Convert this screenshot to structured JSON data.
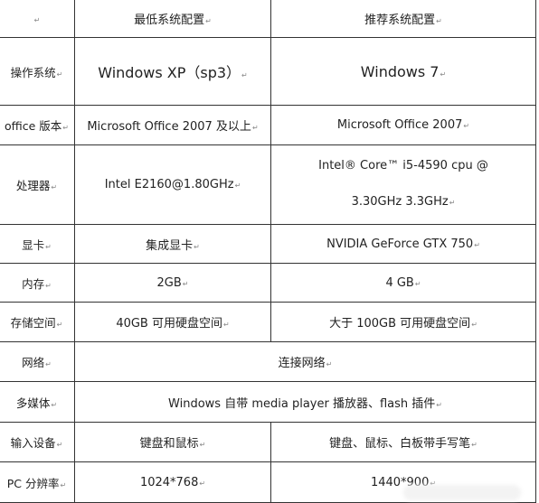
{
  "table": {
    "header": [
      "",
      "最低系统配置",
      "推荐系统配置"
    ],
    "rows": [
      {
        "label": "操作系统",
        "min": "Windows XP（sp3）",
        "rec": "Windows 7"
      },
      {
        "label": "office 版本",
        "min": "Microsoft Office 2007 及以上",
        "rec": "Microsoft Office 2007"
      },
      {
        "label": "处理器",
        "min": "Intel E2160@1.80GHz",
        "rec_lines": [
          "Intel® Core™ i5-4590 cpu @",
          "3.30GHz   3.3GHz"
        ]
      },
      {
        "label": "显卡",
        "min": "集成显卡",
        "rec": "NVIDIA GeForce GTX 750"
      },
      {
        "label": "内存",
        "min": "2GB",
        "rec": "4 GB"
      },
      {
        "label": "存储空间",
        "min": "40GB 可用硬盘空间",
        "rec": "大于 100GB 可用硬盘空间"
      },
      {
        "label": "网络",
        "merged": "连接网络"
      },
      {
        "label": "多媒体",
        "merged": "Windows 自带 media player 播放器、flash 插件"
      },
      {
        "label": "输入设备",
        "min": "键盘和鼠标",
        "rec": "键盘、鼠标、白板带手写笔"
      },
      {
        "label": "PC 分辨率",
        "min": "1024*768",
        "rec": "1440*900"
      }
    ]
  }
}
